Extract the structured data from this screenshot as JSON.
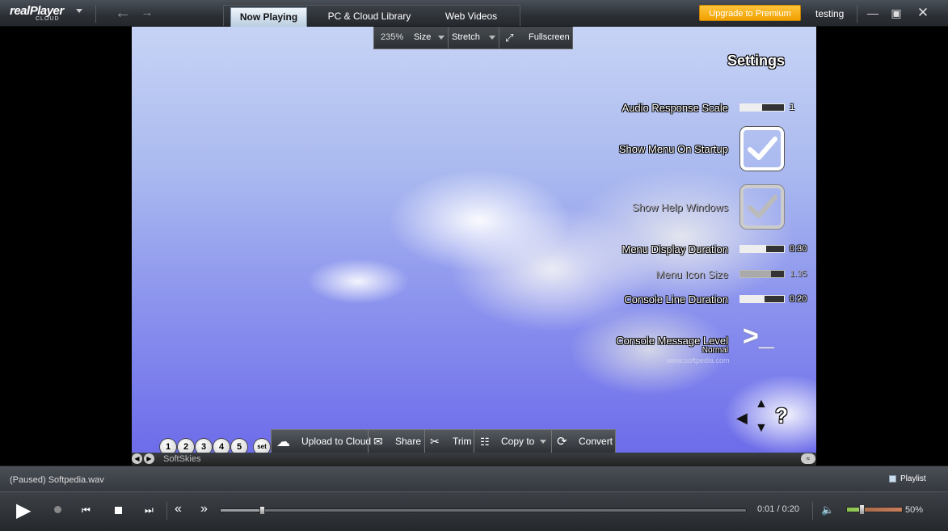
{
  "app": {
    "logo_main": "realPlayer",
    "logo_sub": "CLOUD",
    "tabs": [
      "Now Playing",
      "PC & Cloud Library",
      "Web Videos"
    ],
    "upgrade_label": "Upgrade to Premium",
    "username": "testing"
  },
  "video_toolbar": {
    "zoom": "235%",
    "size_label": "Size",
    "stretch_label": "Stretch",
    "fullscreen_label": "Fullscreen"
  },
  "settings_overlay": {
    "title": "Settings",
    "audio_response_scale": {
      "label": "Audio Response Scale",
      "value": "1",
      "level": 0.5
    },
    "show_menu_on_startup": {
      "label": "Show Menu On Startup",
      "checked": true
    },
    "show_help_windows": {
      "label": "Show Help Windows",
      "checked": true
    },
    "menu_display_duration": {
      "label": "Menu Display Duration",
      "value": "0:30",
      "level": 0.6
    },
    "menu_icon_size": {
      "label": "Menu Icon Size",
      "value": "1.35",
      "level": 0.7
    },
    "console_line_duration": {
      "label": "Console Line Duration",
      "value": "0:20",
      "level": 0.55
    },
    "console_message_level": {
      "label": "Console Message Level",
      "value": "Normal"
    },
    "watermark": "www.softpedia.com",
    "preset_buttons": [
      "1",
      "2",
      "3",
      "4",
      "5"
    ],
    "set_button": "set",
    "help_glyph": "?"
  },
  "action_bar": {
    "upload": "Upload to Cloud",
    "share": "Share",
    "trim": "Trim",
    "copy_to": "Copy to",
    "convert": "Convert"
  },
  "info_strip": {
    "visualization": "SoftSkies"
  },
  "status": {
    "text": "(Paused) Softpedia.wav",
    "playlist_label": "Playlist"
  },
  "playback": {
    "time": "0:01 / 0:20",
    "progress": 0.08,
    "volume_text": "50%",
    "volume": 0.28
  },
  "colors": {
    "upgrade_accent": "#f0a000",
    "active_tab": "#d8e4f0"
  }
}
